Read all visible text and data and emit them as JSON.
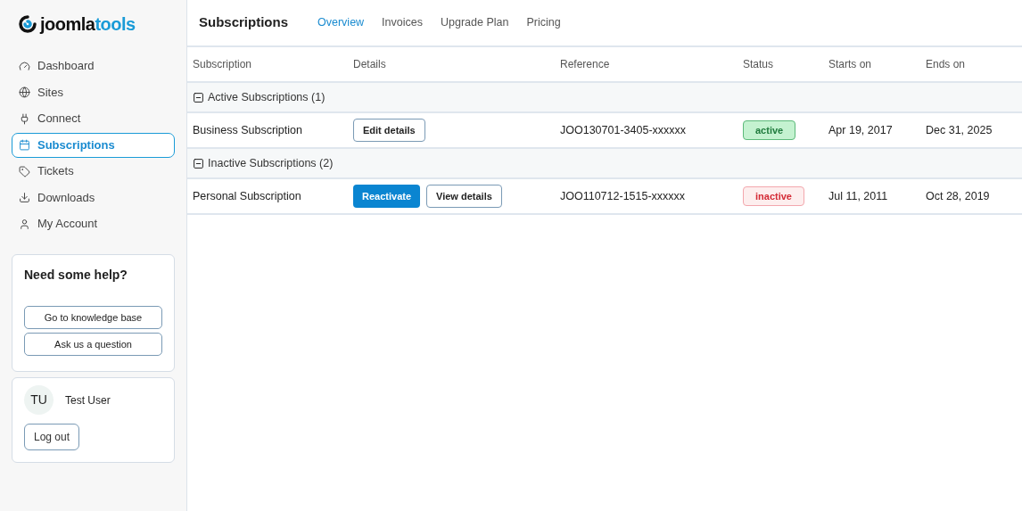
{
  "logo": {
    "part_1": "joomla",
    "part_2": "tools"
  },
  "sidebar": {
    "items": [
      {
        "label": "Dashboard",
        "kind": "gauge",
        "selected": false
      },
      {
        "label": "Sites",
        "kind": "globe",
        "selected": false
      },
      {
        "label": "Connect",
        "kind": "plug",
        "selected": false
      },
      {
        "label": "Subscriptions",
        "kind": "calendar",
        "selected": true
      },
      {
        "label": "Tickets",
        "kind": "tag",
        "selected": false
      },
      {
        "label": "Downloads",
        "kind": "download",
        "selected": false
      },
      {
        "label": "My Account",
        "kind": "user",
        "selected": false
      }
    ]
  },
  "help": {
    "title": "Need some help?",
    "buttons": [
      "Go to knowledge base",
      "Ask us a question"
    ]
  },
  "user": {
    "initials": "TU",
    "name": "Test User",
    "logout": "Log out"
  },
  "header": {
    "title": "Subscriptions",
    "tabs": [
      {
        "label": "Overview",
        "selected": true
      },
      {
        "label": "Invoices",
        "selected": false
      },
      {
        "label": "Upgrade Plan",
        "selected": false
      },
      {
        "label": "Pricing",
        "selected": false
      }
    ]
  },
  "table": {
    "columns": [
      "Subscription",
      "Details",
      "Reference",
      "Status",
      "Starts on",
      "Ends on"
    ],
    "groups": [
      {
        "label": "Active Subscriptions (1)",
        "expanded": true,
        "rows": [
          {
            "name": "Business Subscription",
            "actions": [
              {
                "label": "Edit details",
                "kind": "secondary"
              }
            ],
            "reference": "JOO130701-3405-xxxxxx",
            "status": {
              "label": "active",
              "kind": "active"
            },
            "starts": "Apr 19, 2017",
            "ends": "Dec 31, 2025"
          }
        ]
      },
      {
        "label": "Inactive Subscriptions (2)",
        "expanded": true,
        "rows": [
          {
            "name": "Personal Subscription",
            "actions": [
              {
                "label": "Reactivate",
                "kind": "primary"
              },
              {
                "label": "View details",
                "kind": "secondary"
              }
            ],
            "reference": "JOO110712-1515-xxxxxx",
            "status": {
              "label": "inactive",
              "kind": "inactive"
            },
            "starts": "Jul 11, 2011",
            "ends": "Oct 28, 2019"
          }
        ]
      }
    ]
  }
}
